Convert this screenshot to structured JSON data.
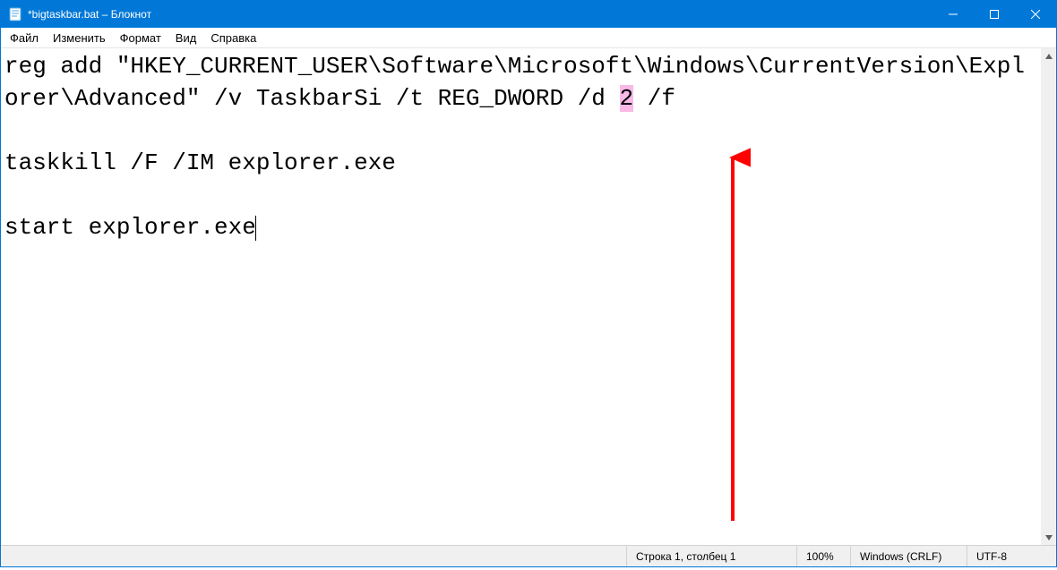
{
  "window": {
    "title": "*bigtaskbar.bat – Блокнот"
  },
  "menubar": {
    "items": [
      "Файл",
      "Изменить",
      "Формат",
      "Вид",
      "Справка"
    ]
  },
  "editor": {
    "line1_a": "reg add \"HKEY_CURRENT_USER\\Software\\Microsoft\\Windows\\CurrentVersion\\Explorer\\Advanced\" /v TaskbarSi /t REG_DWORD /d ",
    "line1_hl": "2",
    "line1_b": " /f",
    "line2": "taskkill /F /IM explorer.exe",
    "line3": "start explorer.exe"
  },
  "highlight_color": "#f8b9e6",
  "statusbar": {
    "pos": "Строка 1, столбец 1",
    "zoom": "100%",
    "eol": "Windows (CRLF)",
    "encoding": "UTF-8"
  },
  "icons": {
    "app": "notepad-icon",
    "minimize": "minimize-icon",
    "maximize": "maximize-icon",
    "close": "close-icon",
    "scroll_up": "scroll-up-icon",
    "scroll_down": "scroll-down-icon"
  }
}
